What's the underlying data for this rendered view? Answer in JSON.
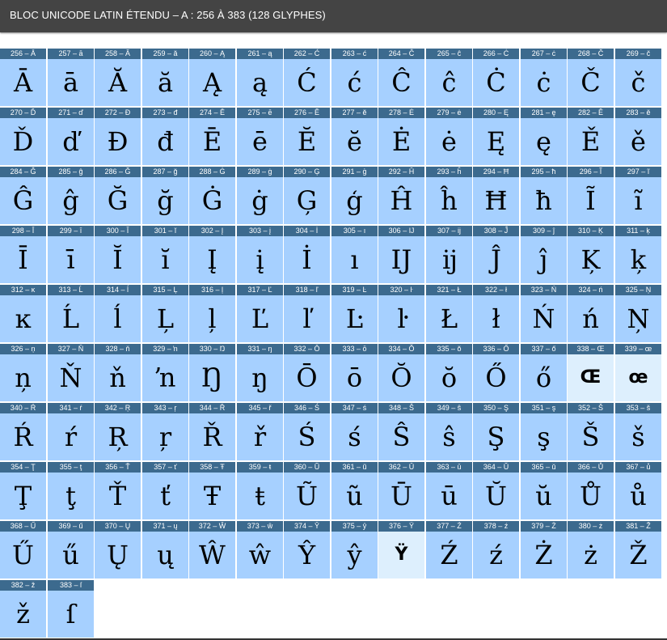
{
  "title": "BLOC UNICODE LATIN ÉTENDU – A : 256 À 383 (128 GLYPHES)",
  "colors": {
    "cell": "#a6d0ff",
    "cell_pale": "#ddeffd",
    "header": "#3c6a8e",
    "title_bar": "#444444"
  },
  "glyphs": [
    {
      "label": "256 – Ā",
      "glyph": "Ā"
    },
    {
      "label": "257 – ā",
      "glyph": "ā"
    },
    {
      "label": "258 – Ă",
      "glyph": "Ă"
    },
    {
      "label": "259 – ă",
      "glyph": "ă"
    },
    {
      "label": "260 – Ą",
      "glyph": "Ą"
    },
    {
      "label": "261 – ą",
      "glyph": "ą"
    },
    {
      "label": "262 – Ć",
      "glyph": "Ć"
    },
    {
      "label": "263 – ć",
      "glyph": "ć"
    },
    {
      "label": "264 – Ĉ",
      "glyph": "Ĉ"
    },
    {
      "label": "265 – ĉ",
      "glyph": "ĉ"
    },
    {
      "label": "266 – Ċ",
      "glyph": "Ċ"
    },
    {
      "label": "267 – ċ",
      "glyph": "ċ"
    },
    {
      "label": "268 – Č",
      "glyph": "Č"
    },
    {
      "label": "269 – č",
      "glyph": "č"
    },
    {
      "label": "270 – Ď",
      "glyph": "Ď"
    },
    {
      "label": "271 – ď",
      "glyph": "ď"
    },
    {
      "label": "272 – Đ",
      "glyph": "Đ"
    },
    {
      "label": "273 – đ",
      "glyph": "đ"
    },
    {
      "label": "274 – Ē",
      "glyph": "Ē"
    },
    {
      "label": "275 – ē",
      "glyph": "ē"
    },
    {
      "label": "276 – Ĕ",
      "glyph": "Ĕ"
    },
    {
      "label": "277 – ĕ",
      "glyph": "ĕ"
    },
    {
      "label": "278 – Ė",
      "glyph": "Ė"
    },
    {
      "label": "279 – ė",
      "glyph": "ė"
    },
    {
      "label": "280 – Ę",
      "glyph": "Ę"
    },
    {
      "label": "281 – ę",
      "glyph": "ę"
    },
    {
      "label": "282 – Ě",
      "glyph": "Ě"
    },
    {
      "label": "283 – ě",
      "glyph": "ě"
    },
    {
      "label": "284 – Ĝ",
      "glyph": "Ĝ"
    },
    {
      "label": "285 – ĝ",
      "glyph": "ĝ"
    },
    {
      "label": "286 – Ğ",
      "glyph": "Ğ"
    },
    {
      "label": "287 – ğ",
      "glyph": "ğ"
    },
    {
      "label": "288 – Ġ",
      "glyph": "Ġ"
    },
    {
      "label": "289 – ġ",
      "glyph": "ġ"
    },
    {
      "label": "290 – Ģ",
      "glyph": "Ģ"
    },
    {
      "label": "291 – ģ",
      "glyph": "ģ"
    },
    {
      "label": "292 – Ĥ",
      "glyph": "Ĥ"
    },
    {
      "label": "293 – ĥ",
      "glyph": "ĥ"
    },
    {
      "label": "294 – Ħ",
      "glyph": "Ħ"
    },
    {
      "label": "295 – ħ",
      "glyph": "ħ"
    },
    {
      "label": "296 – Ĩ",
      "glyph": "Ĩ"
    },
    {
      "label": "297 – ĩ",
      "glyph": "ĩ"
    },
    {
      "label": "298 – Ī",
      "glyph": "Ī"
    },
    {
      "label": "299 – ī",
      "glyph": "ī"
    },
    {
      "label": "300 – Ĭ",
      "glyph": "Ĭ"
    },
    {
      "label": "301 – ĭ",
      "glyph": "ĭ"
    },
    {
      "label": "302 – Į",
      "glyph": "Į"
    },
    {
      "label": "303 – į",
      "glyph": "į"
    },
    {
      "label": "304 – İ",
      "glyph": "İ"
    },
    {
      "label": "305 – ı",
      "glyph": "ı"
    },
    {
      "label": "306 – Ĳ",
      "glyph": "Ĳ"
    },
    {
      "label": "307 – ĳ",
      "glyph": "ĳ"
    },
    {
      "label": "308 – Ĵ",
      "glyph": "Ĵ"
    },
    {
      "label": "309 – ĵ",
      "glyph": "ĵ"
    },
    {
      "label": "310 – Ķ",
      "glyph": "Ķ"
    },
    {
      "label": "311 – ķ",
      "glyph": "ķ"
    },
    {
      "label": "312 – ĸ",
      "glyph": "ĸ"
    },
    {
      "label": "313 – Ĺ",
      "glyph": "Ĺ"
    },
    {
      "label": "314 – ĺ",
      "glyph": "ĺ"
    },
    {
      "label": "315 – Ļ",
      "glyph": "Ļ"
    },
    {
      "label": "316 – ļ",
      "glyph": "ļ"
    },
    {
      "label": "317 – Ľ",
      "glyph": "Ľ"
    },
    {
      "label": "318 – ľ",
      "glyph": "ľ"
    },
    {
      "label": "319 – Ŀ",
      "glyph": "Ŀ"
    },
    {
      "label": "320 – ŀ",
      "glyph": "ŀ"
    },
    {
      "label": "321 – Ł",
      "glyph": "Ł"
    },
    {
      "label": "322 – ł",
      "glyph": "ł"
    },
    {
      "label": "323 – Ń",
      "glyph": "Ń"
    },
    {
      "label": "324 – ń",
      "glyph": "ń"
    },
    {
      "label": "325 – Ņ",
      "glyph": "Ņ"
    },
    {
      "label": "326 – ņ",
      "glyph": "ņ"
    },
    {
      "label": "327 – Ň",
      "glyph": "Ň"
    },
    {
      "label": "328 – ň",
      "glyph": "ň"
    },
    {
      "label": "329 – ŉ",
      "glyph": "ŉ"
    },
    {
      "label": "330 – Ŋ",
      "glyph": "Ŋ"
    },
    {
      "label": "331 – ŋ",
      "glyph": "ŋ"
    },
    {
      "label": "332 – Ō",
      "glyph": "Ō"
    },
    {
      "label": "333 – ō",
      "glyph": "ō"
    },
    {
      "label": "334 – Ŏ",
      "glyph": "Ŏ"
    },
    {
      "label": "335 – ŏ",
      "glyph": "ŏ"
    },
    {
      "label": "336 – Ő",
      "glyph": "Ő"
    },
    {
      "label": "337 – ő",
      "glyph": "ő"
    },
    {
      "label": "338 – Œ",
      "glyph": "Œ",
      "missing": true
    },
    {
      "label": "339 – œ",
      "glyph": "œ",
      "missing": true
    },
    {
      "label": "340 – Ŕ",
      "glyph": "Ŕ"
    },
    {
      "label": "341 – ŕ",
      "glyph": "ŕ"
    },
    {
      "label": "342 – Ŗ",
      "glyph": "Ŗ"
    },
    {
      "label": "343 – ŗ",
      "glyph": "ŗ"
    },
    {
      "label": "344 – Ř",
      "glyph": "Ř"
    },
    {
      "label": "345 – ř",
      "glyph": "ř"
    },
    {
      "label": "346 – Ś",
      "glyph": "Ś"
    },
    {
      "label": "347 – ś",
      "glyph": "ś"
    },
    {
      "label": "348 – Ŝ",
      "glyph": "Ŝ"
    },
    {
      "label": "349 – ŝ",
      "glyph": "ŝ"
    },
    {
      "label": "350 – Ş",
      "glyph": "Ş"
    },
    {
      "label": "351 – ş",
      "glyph": "ş"
    },
    {
      "label": "352 – Š",
      "glyph": "Š"
    },
    {
      "label": "353 – š",
      "glyph": "š"
    },
    {
      "label": "354 – Ţ",
      "glyph": "Ţ"
    },
    {
      "label": "355 – ţ",
      "glyph": "ţ"
    },
    {
      "label": "356 – Ť",
      "glyph": "Ť"
    },
    {
      "label": "357 – ť",
      "glyph": "ť"
    },
    {
      "label": "358 – Ŧ",
      "glyph": "Ŧ"
    },
    {
      "label": "359 – ŧ",
      "glyph": "ŧ"
    },
    {
      "label": "360 – Ũ",
      "glyph": "Ũ"
    },
    {
      "label": "361 – ũ",
      "glyph": "ũ"
    },
    {
      "label": "362 – Ū",
      "glyph": "Ū"
    },
    {
      "label": "363 – ū",
      "glyph": "ū"
    },
    {
      "label": "364 – Ŭ",
      "glyph": "Ŭ"
    },
    {
      "label": "365 – ŭ",
      "glyph": "ŭ"
    },
    {
      "label": "366 – Ů",
      "glyph": "Ů"
    },
    {
      "label": "367 – ů",
      "glyph": "ů"
    },
    {
      "label": "368 – Ű",
      "glyph": "Ű"
    },
    {
      "label": "369 – ű",
      "glyph": "ű"
    },
    {
      "label": "370 – Ų",
      "glyph": "Ų"
    },
    {
      "label": "371 – ų",
      "glyph": "ų"
    },
    {
      "label": "372 – Ŵ",
      "glyph": "Ŵ"
    },
    {
      "label": "373 – ŵ",
      "glyph": "ŵ"
    },
    {
      "label": "374 – Ŷ",
      "glyph": "Ŷ"
    },
    {
      "label": "375 – ŷ",
      "glyph": "ŷ"
    },
    {
      "label": "376 – Ÿ",
      "glyph": "Ÿ",
      "missing": true
    },
    {
      "label": "377 – Ź",
      "glyph": "Ź"
    },
    {
      "label": "378 – ź",
      "glyph": "ź"
    },
    {
      "label": "379 – Ż",
      "glyph": "Ż"
    },
    {
      "label": "380 – ż",
      "glyph": "ż"
    },
    {
      "label": "381 – Ž",
      "glyph": "Ž"
    },
    {
      "label": "382 – ž",
      "glyph": "ž"
    },
    {
      "label": "383 – ſ",
      "glyph": "ſ"
    }
  ]
}
